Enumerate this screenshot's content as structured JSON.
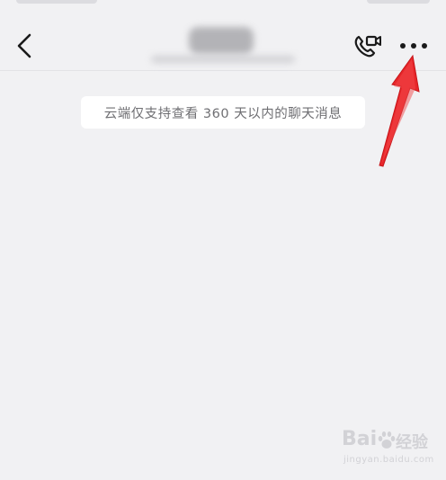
{
  "notice": {
    "text": "云端仅支持查看 360 天以内的聊天消息"
  },
  "icons": {
    "back": "back-chevron-icon",
    "video_call": "video-call-icon",
    "more": "more-dots-icon"
  },
  "annotation": {
    "color": "#e8262a"
  },
  "watermark": {
    "brand": "Bai",
    "suffix": "经验",
    "url": "jingyan.baidu.com"
  }
}
